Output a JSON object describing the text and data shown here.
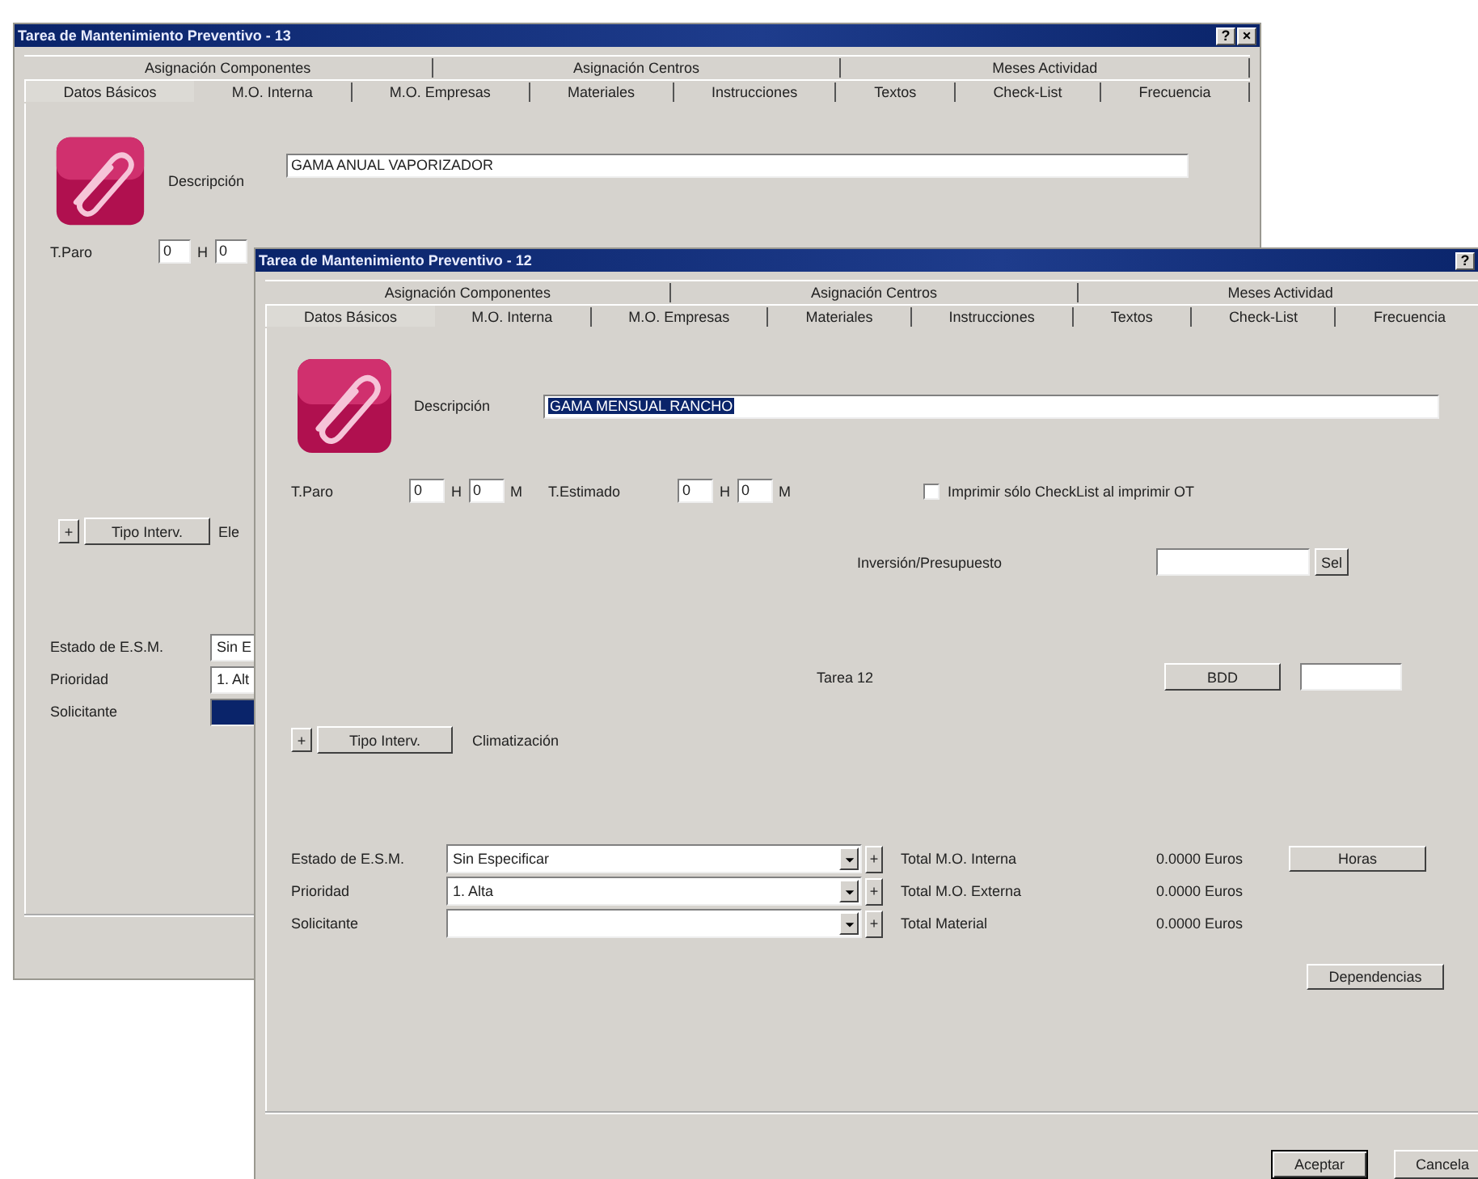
{
  "windows": [
    {
      "title": "Tarea de Mantenimiento Preventivo - 13",
      "title_buttons": [
        "?",
        "×"
      ],
      "tab_rows": [
        [
          {
            "label": "Asignación Componentes",
            "selected": false
          },
          {
            "label": "Asignación Centros",
            "selected": false
          },
          {
            "label": "Meses Actividad",
            "selected": false
          }
        ],
        [
          {
            "label": "Datos Básicos",
            "selected": true
          },
          {
            "label": "M.O. Interna",
            "selected": false
          },
          {
            "label": "M.O. Empresas",
            "selected": false
          },
          {
            "label": "Materiales",
            "selected": false
          },
          {
            "label": "Instrucciones",
            "selected": false
          },
          {
            "label": "Textos",
            "selected": false
          },
          {
            "label": "Check-List",
            "selected": false
          },
          {
            "label": "Frecuencia",
            "selected": false
          }
        ]
      ],
      "description": {
        "label": "Descripción",
        "value": "GAMA ANUAL VAPORIZADOR",
        "selected": false
      },
      "times": [
        {
          "label": "T.Paro",
          "hours": "0",
          "h_unit": "H",
          "minutes": "0"
        }
      ],
      "interv": {
        "plus": "+",
        "button": "Tipo Interv.",
        "value": "Ele"
      },
      "combos": [
        {
          "label": "Estado de E.S.M.",
          "value": "Sin E",
          "highlighted": false
        },
        {
          "label": "Prioridad",
          "value": "1. Alt",
          "highlighted": false
        },
        {
          "label": "Solicitante",
          "highlighted": true
        }
      ]
    },
    {
      "title": "Tarea de Mantenimiento Preventivo - 12",
      "title_buttons": [
        "?"
      ],
      "tab_rows": [
        [
          {
            "label": "Asignación Componentes",
            "selected": false
          },
          {
            "label": "Asignación Centros",
            "selected": false
          },
          {
            "label": "Meses Actividad",
            "selected": false
          }
        ],
        [
          {
            "label": "Datos Básicos",
            "selected": true
          },
          {
            "label": "M.O. Interna",
            "selected": false
          },
          {
            "label": "M.O. Empresas",
            "selected": false
          },
          {
            "label": "Materiales",
            "selected": false
          },
          {
            "label": "Instrucciones",
            "selected": false
          },
          {
            "label": "Textos",
            "selected": false
          },
          {
            "label": "Check-List",
            "selected": false
          },
          {
            "label": "Frecuencia",
            "selected": false
          }
        ]
      ],
      "description": {
        "label": "Descripción",
        "value": "GAMA MENSUAL RANCHO",
        "selected": true
      },
      "times": [
        {
          "label": "T.Paro",
          "hours": "0",
          "h_unit": "H",
          "minutes": "0",
          "m_unit": "M"
        },
        {
          "label": "T.Estimado",
          "hours": "0",
          "h_unit": "H",
          "minutes": "0",
          "m_unit": "M"
        }
      ],
      "checkbox": {
        "label": "Imprimir sólo CheckList al imprimir OT",
        "checked": false
      },
      "budget": {
        "label": "Inversión/Presupuesto",
        "button": "Sel"
      },
      "task": {
        "label": "Tarea 12",
        "button": "BDD"
      },
      "interv": {
        "plus": "+",
        "button": "Tipo Interv.",
        "value": "Climatización"
      },
      "combos": [
        {
          "label": "Estado de E.S.M.",
          "value": "Sin Especificar",
          "highlighted": false
        },
        {
          "label": "Prioridad",
          "value": "1. Alta",
          "highlighted": false
        },
        {
          "label": "Solicitante",
          "highlighted": false
        }
      ],
      "totals": [
        {
          "plus": "+",
          "label": "Total M.O. Interna",
          "value": "0.0000 Euros"
        },
        {
          "plus": "+",
          "label": "Total M.O. Externa",
          "value": "0.0000 Euros"
        },
        {
          "plus": "+",
          "label": "Total Material",
          "value": "0.0000 Euros"
        }
      ],
      "side_buttons": [
        "Horas",
        "Dependencias"
      ],
      "footer_buttons": [
        "Aceptar",
        "Cancela"
      ]
    }
  ]
}
